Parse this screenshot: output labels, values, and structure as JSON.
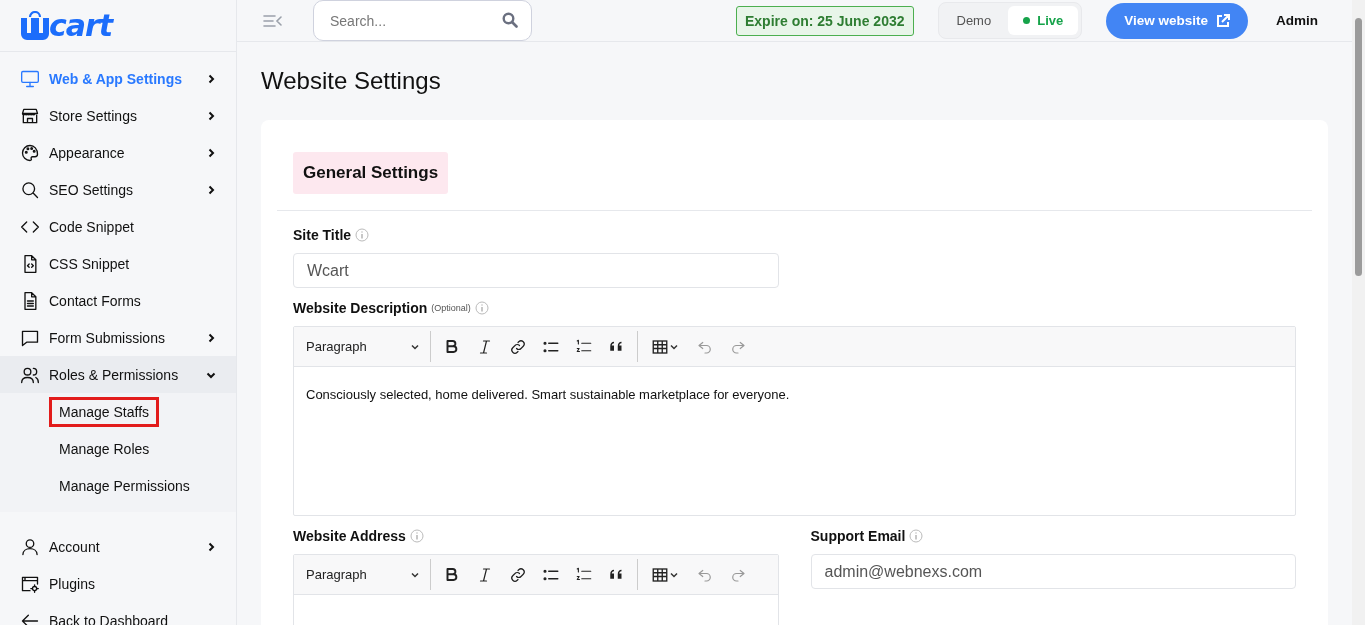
{
  "logo": {
    "text": "cart"
  },
  "sidebar": {
    "groups": [
      {
        "items": [
          {
            "label": "Web & App Settings",
            "selected": true,
            "expandable": true,
            "expanded": false
          },
          {
            "label": "Store Settings",
            "selected": false,
            "expandable": true,
            "expanded": false
          },
          {
            "label": "Appearance",
            "selected": false,
            "expandable": true,
            "expanded": false
          },
          {
            "label": "SEO Settings",
            "selected": false,
            "expandable": true,
            "expanded": false
          },
          {
            "label": "Code Snippet",
            "selected": false,
            "expandable": false,
            "expanded": false
          },
          {
            "label": "CSS Snippet",
            "selected": false,
            "expandable": false,
            "expanded": false
          },
          {
            "label": "Contact Forms",
            "selected": false,
            "expandable": false,
            "expanded": false
          },
          {
            "label": "Form Submissions",
            "selected": false,
            "expandable": true,
            "expanded": false
          },
          {
            "label": "Roles & Permissions",
            "selected": false,
            "expandable": true,
            "expanded": true,
            "children": [
              {
                "label": "Manage Staffs",
                "outlined": true
              },
              {
                "label": "Manage Roles",
                "outlined": false
              },
              {
                "label": "Manage Permissions",
                "outlined": false
              }
            ]
          }
        ]
      },
      {
        "items": [
          {
            "label": "Account",
            "selected": false,
            "expandable": true,
            "expanded": false
          },
          {
            "label": "Plugins",
            "selected": false,
            "expandable": false,
            "expanded": false
          },
          {
            "label": "Back to Dashboard",
            "selected": false,
            "expandable": false,
            "expanded": false
          }
        ]
      }
    ]
  },
  "header": {
    "search": {
      "placeholder": "Search..."
    },
    "expiry": "Expire on: 25 June 2032",
    "mode_toggle": [
      {
        "label": "Demo",
        "selected": false
      },
      {
        "label": "Live",
        "selected": true
      }
    ],
    "view_button": "View website",
    "user": "Admin"
  },
  "page": {
    "title": "Website Settings",
    "section_title": "General Settings",
    "rows": [
      [
        {
          "kind": "text",
          "label": "Site Title",
          "value": "Wcart"
        }
      ],
      [
        {
          "kind": "editor",
          "label": "Website Description",
          "optional": "(Optional)",
          "format": "Paragraph",
          "value": "Consciously selected, home delivered. Smart sustainable marketplace for everyone."
        }
      ],
      [
        {
          "kind": "editor",
          "label": "Website Address",
          "format": "Paragraph"
        },
        {
          "kind": "text",
          "label": "Support Email",
          "value": "admin@webnexs.com"
        }
      ]
    ]
  }
}
